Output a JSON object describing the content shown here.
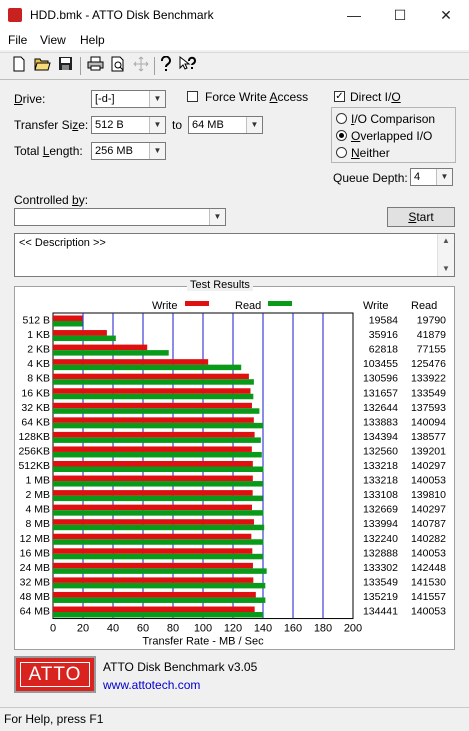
{
  "window": {
    "title": "HDD.bmk - ATTO Disk Benchmark",
    "minimize_glyph": "—",
    "maximize_glyph": "☐",
    "close_glyph": "✕"
  },
  "menu": {
    "items": [
      "File",
      "View",
      "Help"
    ]
  },
  "toolbar": {
    "icons": [
      "new-icon",
      "open-icon",
      "save-icon",
      "print-icon",
      "print-preview-icon",
      "move-icon",
      "help-icon",
      "context-help-icon"
    ]
  },
  "settings": {
    "drive_label": "Drive:",
    "drive_value": "[-d-]",
    "transfer_size_label": "Transfer Size:",
    "transfer_from": "512 B",
    "transfer_to_label": "to",
    "transfer_to": "64 MB",
    "total_length_label": "Total Length:",
    "total_length": "256 MB",
    "force_write_label": "Force Write Access",
    "force_write_checked": false,
    "direct_io_label": "Direct I/O",
    "direct_io_checked": true,
    "io_comparison_label": "I/O Comparison",
    "overlapped_io_label": "Overlapped I/O",
    "neither_label": "Neither",
    "selected_io_mode": "Overlapped I/O",
    "queue_depth_label": "Queue Depth:",
    "queue_depth": "4",
    "controlled_by_label": "Controlled by:",
    "controlled_by_value": "",
    "start_label": "Start",
    "description": "<< Description >>"
  },
  "results": {
    "title": "Test Results",
    "write_legend": "Write",
    "read_legend": "Read",
    "write_column": "Write",
    "read_column": "Read",
    "write_color": "#e01010",
    "read_color": "#0a9a1a",
    "axis_label": "Transfer Rate - MB / Sec"
  },
  "chart_data": {
    "type": "bar",
    "orientation": "horizontal",
    "categories": [
      "512 B",
      "1 KB",
      "2 KB",
      "4 KB",
      "8 KB",
      "16 KB",
      "32 KB",
      "64 KB",
      "128KB",
      "256KB",
      "512KB",
      "1 MB",
      "2 MB",
      "4 MB",
      "8 MB",
      "12 MB",
      "16 MB",
      "24 MB",
      "32 MB",
      "48 MB",
      "64 MB"
    ],
    "series": [
      {
        "name": "Write",
        "values": [
          19584,
          35916,
          62818,
          103455,
          130596,
          131657,
          132644,
          133883,
          134394,
          132560,
          133218,
          133218,
          133108,
          132669,
          133994,
          132240,
          132888,
          133302,
          133549,
          135219,
          134441
        ]
      },
      {
        "name": "Read",
        "values": [
          19790,
          41879,
          77155,
          125476,
          133922,
          133549,
          137593,
          140094,
          138577,
          139201,
          140297,
          140053,
          139810,
          140297,
          140787,
          140282,
          140053,
          142448,
          141530,
          141557,
          140053
        ]
      }
    ],
    "xlabel": "Transfer Rate - MB / Sec",
    "xlim": [
      0,
      200
    ],
    "xticks": [
      0,
      20,
      40,
      60,
      80,
      100,
      120,
      140,
      160,
      180,
      200
    ],
    "grid": true,
    "legend": "top"
  },
  "footer": {
    "product": "ATTO Disk Benchmark v3.05",
    "url": "www.attotech.com",
    "logo_text": "ATTO"
  },
  "status": {
    "text": "For Help, press F1"
  }
}
